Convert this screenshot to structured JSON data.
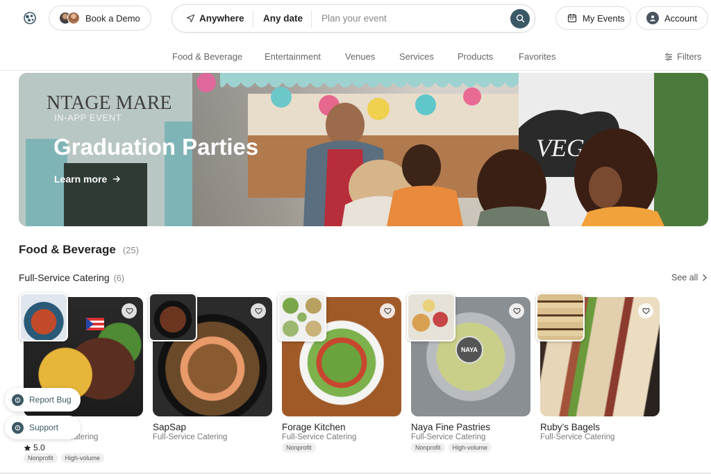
{
  "header": {
    "book_demo": "Book a Demo",
    "search": {
      "where": "Anywhere",
      "when": "Any date",
      "placeholder": "Plan your event"
    },
    "my_events": "My Events",
    "account": "Account"
  },
  "categories": [
    "Food & Beverage",
    "Entertainment",
    "Venues",
    "Services",
    "Products",
    "Favorites"
  ],
  "filters_label": "Filters",
  "hero": {
    "eyebrow": "IN-APP EVENT",
    "title": "Graduation Parties",
    "cta": "Learn more",
    "background_text": [
      "NTAGE MARE",
      "VEGAN"
    ]
  },
  "section": {
    "title": "Food & Beverage",
    "count": "(25)",
    "subsection": {
      "title": "Full-Service Catering",
      "count": "(6)",
      "see_all": "See all"
    }
  },
  "cards": [
    {
      "name": "",
      "category": "Full-Service Catering",
      "rating": "5.0",
      "tags": [
        "Nonprofit",
        "High-volume"
      ]
    },
    {
      "name": "SapSap",
      "category": "Full-Service Catering",
      "rating": "",
      "tags": []
    },
    {
      "name": "Forage Kitchen",
      "category": "Full-Service Catering",
      "rating": "",
      "tags": [
        "Nonprofit"
      ]
    },
    {
      "name": "Naya Fine Pastries",
      "category": "Full-Service Catering",
      "rating": "",
      "tags": [
        "Nonprofit",
        "High-volume"
      ],
      "badge": "NAYA"
    },
    {
      "name": "Ruby’s Bagels",
      "category": "Full-Service Catering",
      "rating": "",
      "tags": []
    }
  ],
  "floating": {
    "report_bug": "Report Bug",
    "support": "Support"
  },
  "colors": {
    "accent": "#3b5866",
    "text": "#222222",
    "muted": "#777777",
    "border": "#dcdcdc"
  },
  "icons": [
    "logo-icon",
    "navigation-arrow-icon",
    "search-icon",
    "calendar-icon",
    "user-icon",
    "filters-icon",
    "arrow-right-icon",
    "chevron-right-icon",
    "heart-icon",
    "star-icon",
    "info-icon"
  ]
}
